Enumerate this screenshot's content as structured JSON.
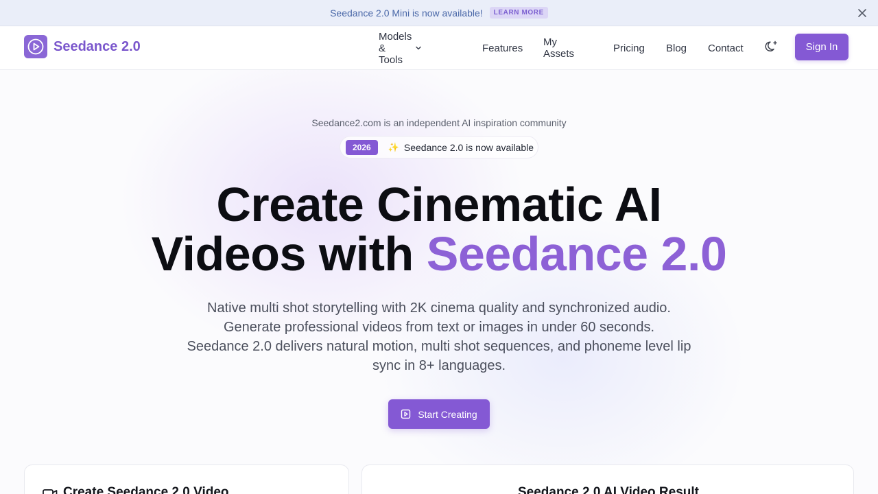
{
  "announcement": {
    "text": "Seedance 2.0 Mini is now available!",
    "link_label": "LEARN MORE",
    "close_icon": "close-icon"
  },
  "header": {
    "logo_text": "Seedance 2.0",
    "logo_icon": "play-circle-icon",
    "nav": {
      "models_tools": "Models & Tools",
      "features": "Features",
      "my_assets": "My Assets",
      "pricing": "Pricing",
      "blog": "Blog",
      "contact": "Contact"
    },
    "theme_icon": "moon-sparkle-icon",
    "sign_in": "Sign In"
  },
  "hero": {
    "community": "Seedance2.com is an independent AI inspiration community",
    "badge_year": "2026",
    "badge_spark": "✨",
    "badge_text": "Seedance 2.0 is now available",
    "title_line1": "Create Cinematic AI",
    "title_line2_prefix": "Videos with ",
    "title_line2_accent": "Seedance 2.0",
    "description_lines": [
      "Native multi shot storytelling with 2K cinema quality and synchronized audio.",
      "Generate professional videos from text or images in under 60 seconds.",
      "Seedance 2.0 delivers natural motion, multi shot sequences, and phoneme level lip",
      "sync in 8+ languages."
    ],
    "cta_label": "Start Creating"
  },
  "cards": {
    "create_title": "Create Seedance 2.0 Video",
    "result_title": "Seedance 2.0 AI Video Result"
  },
  "colors": {
    "accent": "#8459d4",
    "accent_text": "#8d61d6",
    "announce_bg": "#eaeef9",
    "announce_text": "#4a68a8"
  }
}
